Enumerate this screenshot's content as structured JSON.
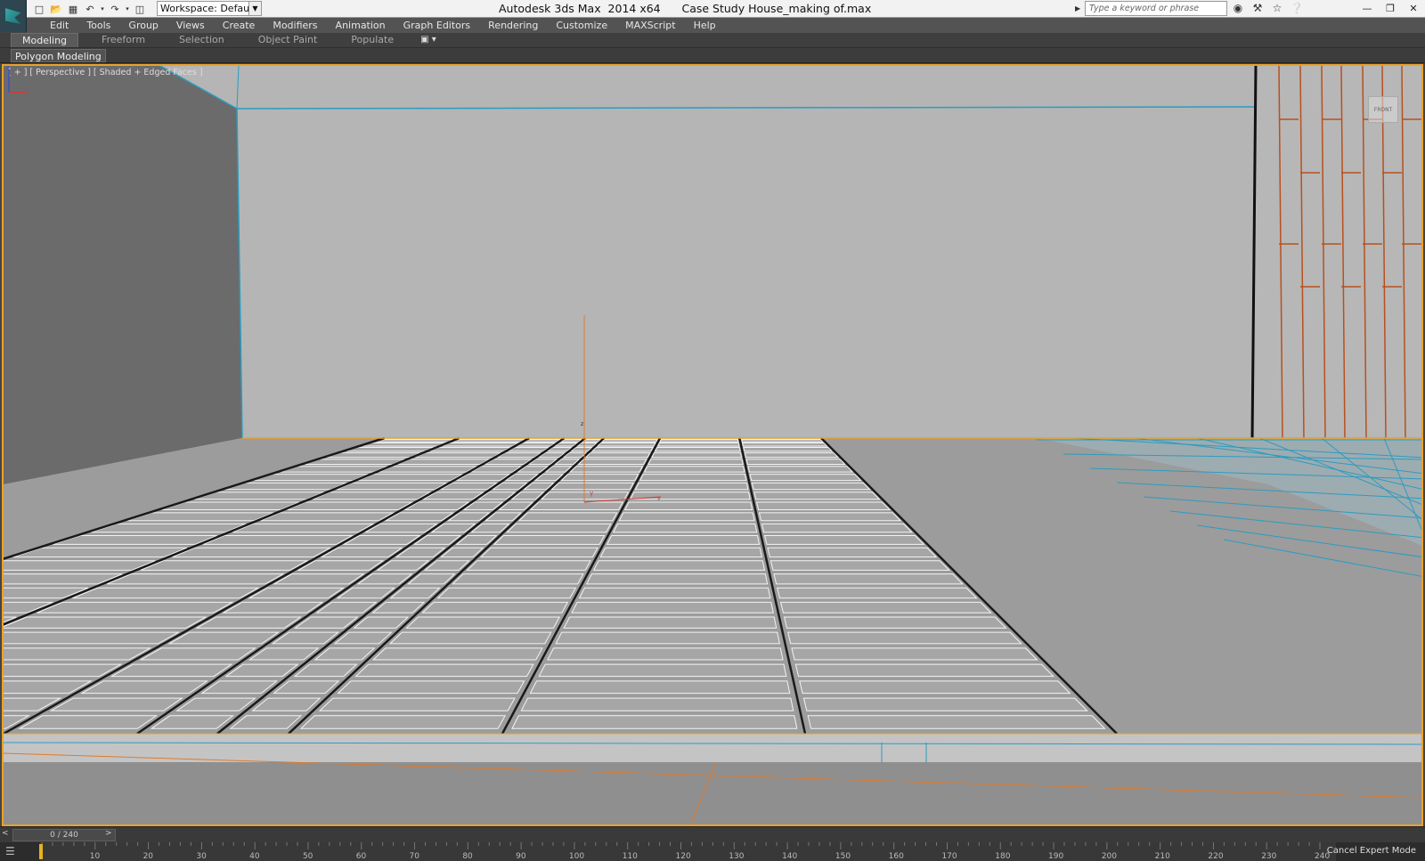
{
  "titlebar": {
    "title": "Autodesk 3ds Max  2014 x64      Case Study House_making of.max",
    "workspace": "Workspace: Default",
    "search_placeholder": "Type a keyword or phrase",
    "quick_access_icons": [
      "new-file-icon",
      "open-file-icon",
      "save-icon",
      "undo-icon",
      "redo-icon",
      "project-folder-icon"
    ],
    "tools_icons": [
      "binoculars-icon",
      "tools-icon",
      "star-icon",
      "help-icon"
    ],
    "window_controls": [
      "minimize-icon",
      "restore-icon",
      "close-icon"
    ]
  },
  "menubar": {
    "items": [
      "Edit",
      "Tools",
      "Group",
      "Views",
      "Create",
      "Modifiers",
      "Animation",
      "Graph Editors",
      "Rendering",
      "Customize",
      "MAXScript",
      "Help"
    ]
  },
  "ribbon": {
    "tabs": [
      "Modeling",
      "Freeform",
      "Selection",
      "Object Paint",
      "Populate"
    ],
    "active": "Modeling",
    "subtab": "Polygon Modeling"
  },
  "viewport": {
    "label": "[ + ] [ Perspective ] [ Shaded + Edged Faces ]",
    "viewcube_label": "FRONT",
    "gizmo_labels": {
      "z": "z",
      "y": "y",
      "x": "x"
    },
    "tripod_labels": {
      "z": "z",
      "x": "x"
    },
    "colors": {
      "background": "#b4b4b4",
      "selection": "#2b9cc0",
      "gizmo_z": "#e07a2a",
      "gizmo_x": "#d23a3a",
      "border": "#e9a22a"
    }
  },
  "timeline": {
    "frame_readout": "0 / 240",
    "prev": "<",
    "next": ">",
    "ticks": [
      10,
      20,
      30,
      40,
      50,
      60,
      70,
      80,
      90,
      100,
      110,
      120,
      130,
      140,
      150,
      160,
      170,
      180,
      190,
      200,
      210,
      220,
      230,
      240
    ],
    "status": "Cancel Expert Mode"
  }
}
